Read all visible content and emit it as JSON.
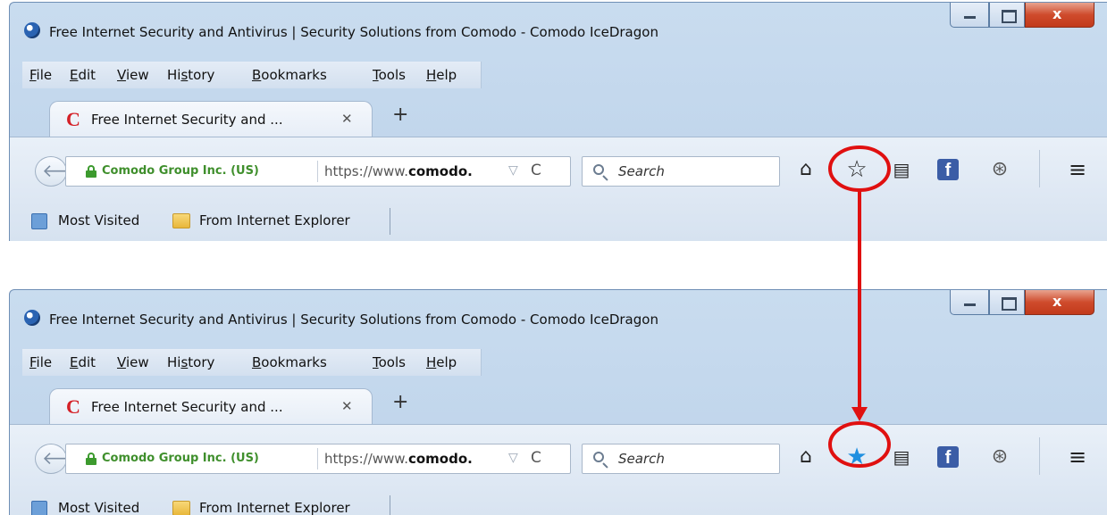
{
  "window_title": "Free Internet Security and Antivirus | Security Solutions from Comodo - Comodo IceDragon",
  "caption_buttons": {
    "close_glyph": "x"
  },
  "menu": {
    "file": {
      "accel": "F",
      "rest": "ile"
    },
    "edit": {
      "accel": "E",
      "rest": "dit"
    },
    "view": {
      "accel": "V",
      "rest": "iew"
    },
    "history": {
      "pre": "Hi",
      "accel": "s",
      "rest": "tory"
    },
    "bookmarks": {
      "accel": "B",
      "rest": "ookmarks"
    },
    "tools": {
      "accel": "T",
      "rest": "ools"
    },
    "help": {
      "accel": "H",
      "rest": "elp"
    }
  },
  "tab": {
    "title": "Free Internet Security and ...",
    "close_glyph": "✕",
    "favicon_letter": "C"
  },
  "new_tab_glyph": "+",
  "urlbar": {
    "identity": "Comodo Group Inc. (US)",
    "url_prefix": "https://www.",
    "url_domain": "comodo.",
    "dropdown_glyph": "▽",
    "reload_glyph": "C"
  },
  "search": {
    "placeholder": "Search"
  },
  "toolbar_icons": {
    "home": "home-icon",
    "star_empty": "star-outline-icon",
    "star_filled": "star-filled-icon",
    "reading": "reading-list-icon",
    "facebook": "facebook-icon",
    "globe": "globe-icon",
    "menu": "hamburger-menu-icon"
  },
  "bookmarks_bar": {
    "most_visited": "Most Visited",
    "from_ie": "From Internet Explorer"
  },
  "colors": {
    "highlight_red": "#e01010",
    "star_filled": "#1f8fe0",
    "identity_green": "#3f8f2c"
  },
  "annotation": {
    "description": "star-before-and-after-bookmark"
  }
}
